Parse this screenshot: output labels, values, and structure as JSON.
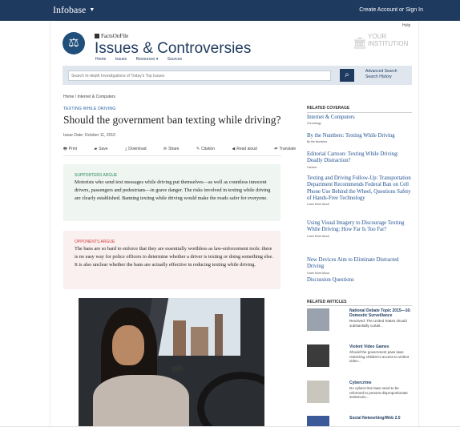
{
  "topbar": {
    "brand": "Infobase",
    "caret": "▼",
    "signin": "Create Account or Sign In",
    "help": "Help"
  },
  "header": {
    "publisher": "FactsOnFile",
    "site_title": "Issues & Controversies",
    "nav": [
      "Home",
      "Issues",
      "Resources ▾",
      "Sources"
    ],
    "institution": [
      "YOUR",
      "INSTITUTION"
    ]
  },
  "search": {
    "placeholder": "Search In-depth Investigations of Today's Top Issues",
    "button_icon": "search-icon",
    "advanced": "Advanced Search",
    "history": "Search History"
  },
  "breadcrumb": "Home / Internet & Computers",
  "article": {
    "section": "TEXTING WHILE DRIVING",
    "title": "Should the government ban texting while driving?",
    "issue_date": "Issue Date: October 11, 2010",
    "tools": [
      {
        "icon": "print-icon",
        "glyph": "🖶",
        "label": "Print"
      },
      {
        "icon": "save-icon",
        "glyph": "▰",
        "label": "Save"
      },
      {
        "icon": "download-icon",
        "glyph": "⤓",
        "label": "Download"
      },
      {
        "icon": "share-icon",
        "glyph": "✉",
        "label": "Share"
      },
      {
        "icon": "citation-icon",
        "glyph": "✎",
        "label": "Citation"
      },
      {
        "icon": "read-aloud-icon",
        "glyph": "◀",
        "label": "Read aloud"
      },
      {
        "icon": "translate-icon",
        "glyph": "⇄",
        "label": "Translate"
      }
    ],
    "supporters": {
      "heading": "SUPPORTERS ARGUE",
      "body": "Motorists who send text messages while driving put themselves—as well as countless innocent drivers, passengers and pedestrians—in grave danger. The risks involved in texting while driving are clearly established. Banning texting while driving would make the roads safer for everyone."
    },
    "opponents": {
      "heading": "OPPONENTS ARGUE",
      "body": "The bans are so hard to enforce that they are essentially worthless as law-enforcement tools: there is no easy way for police officers to determine whether a driver is texting or doing something else. It is also unclear whether the bans are actually effective in reducing texting while driving."
    }
  },
  "related_coverage": {
    "heading": "RELATED COVERAGE",
    "items": [
      {
        "title": "Internet & Computers",
        "sub": "Chronology"
      },
      {
        "title": "By the Numbers: Texting While Driving",
        "sub": "By the Numbers"
      },
      {
        "title": "Editorial Cartoon: Texting While Driving: Deadly Distraction?",
        "sub": "Cartoon"
      },
      {
        "title": "Texting and Driving Follow-Up: Transportation Department Recommends Federal Ban on Cell Phone Use Behind the Wheel, Questions Safety of Hands-Free Technology",
        "sub": "Learn More About"
      },
      {
        "title": "Using Visual Imagery to Discourage Texting While Driving: How Far Is Too Far?",
        "sub": "Learn More About"
      },
      {
        "title": "New Devices Aim to Eliminate Distracted Driving",
        "sub": "Learn More About"
      },
      {
        "title": "Discussion Questions",
        "sub": ""
      }
    ]
  },
  "related_articles": {
    "heading": "RELATED ARTICLES",
    "items": [
      {
        "title": "National Debate Topic 2015—16: Domestic Surveillance",
        "desc": "Resolved: The United States should substantially curtail..."
      },
      {
        "title": "Violent Video Games",
        "desc": "Should the government pass laws restricting children's access to violent video..."
      },
      {
        "title": "Cybercrime",
        "desc": "Do cybercrime laws need to be reformed to prevent disproportionate sentences..."
      },
      {
        "title": "Social Networking/Web 2.0",
        "desc": ""
      }
    ]
  }
}
